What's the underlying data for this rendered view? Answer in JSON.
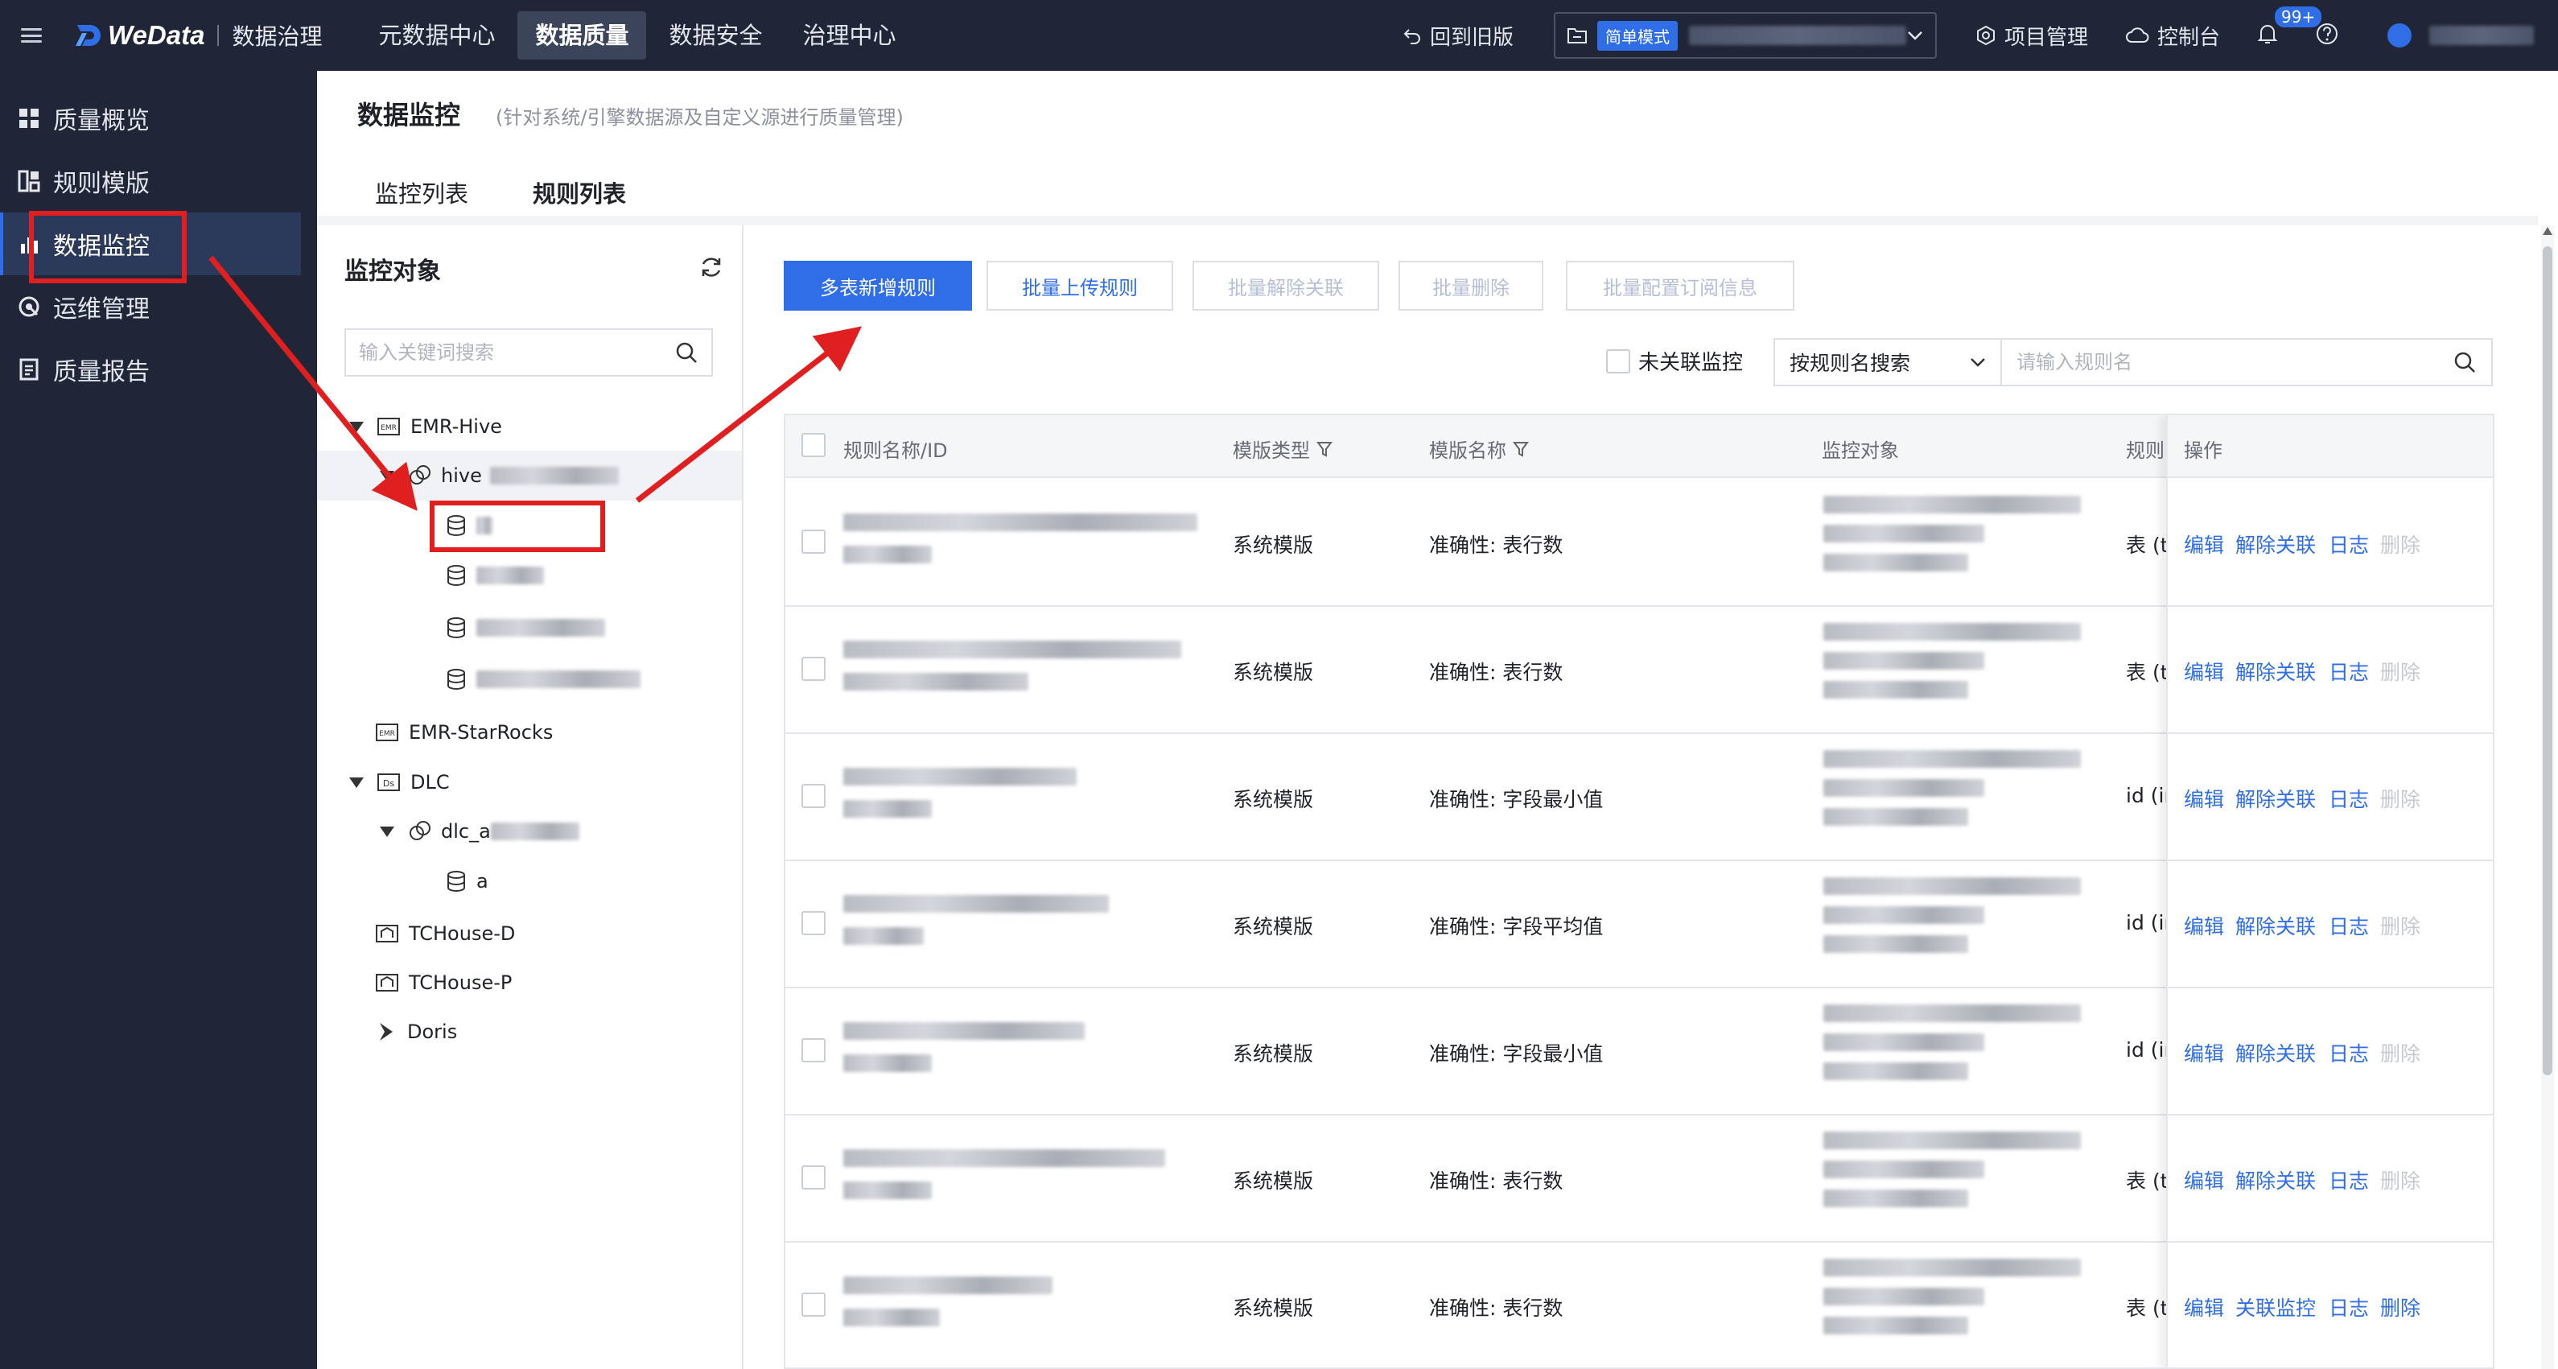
{
  "topbar": {
    "logo_text": "WeData",
    "product": "数据治理",
    "nav": [
      "元数据中心",
      "数据质量",
      "数据安全",
      "治理中心"
    ],
    "active_nav": "数据质量",
    "back_old": "回到旧版",
    "mode_badge": "简单模式",
    "project_mgmt": "项目管理",
    "console": "控制台",
    "notif_count": "99+"
  },
  "sidebar": {
    "items": [
      {
        "label": "质量概览",
        "icon": "grid-icon"
      },
      {
        "label": "规则模版",
        "icon": "template-icon"
      },
      {
        "label": "数据监控",
        "icon": "bar-chart-icon"
      },
      {
        "label": "运维管理",
        "icon": "ops-icon"
      },
      {
        "label": "质量报告",
        "icon": "report-icon"
      }
    ],
    "active": "数据监控"
  },
  "page": {
    "title": "数据监控",
    "desc": "(针对系统/引擎数据源及自定义源进行质量管理)",
    "tabs": [
      "监控列表",
      "规则列表"
    ],
    "active_tab": "规则列表"
  },
  "tree": {
    "title": "监控对象",
    "search_placeholder": "输入关键词搜索",
    "nodes": {
      "emr_hive": "EMR-Hive",
      "hive_db": "hive",
      "emr_starrocks": "EMR-StarRocks",
      "dlc": "DLC",
      "dlc_db": "dlc_a",
      "dlc_table": "a",
      "tchouse_d": "TCHouse-D",
      "tchouse_p": "TCHouse-P",
      "doris": "Doris"
    }
  },
  "toolbar": {
    "add_multi": "多表新增规则",
    "batch_upload": "批量上传规则",
    "batch_unlink": "批量解除关联",
    "batch_delete": "批量删除",
    "batch_subscribe": "批量配置订阅信息",
    "unlinked_label": "未关联监控",
    "search_mode": "按规则名搜索",
    "search_placeholder": "请输入规则名"
  },
  "table": {
    "headers": {
      "name": "规则名称/ID",
      "template_type": "模版类型",
      "template_name": "模版名称",
      "monitor_obj": "监控对象",
      "rule": "规则",
      "ops": "操作"
    },
    "rows": [
      {
        "template_type": "系统模版",
        "template_name": "准确性: 表行数",
        "rule": "表 (t",
        "ops": [
          "编辑",
          "解除关联",
          "日志",
          "删除"
        ],
        "delete_enabled": false
      },
      {
        "template_type": "系统模版",
        "template_name": "准确性: 表行数",
        "rule": "表 (t",
        "ops": [
          "编辑",
          "解除关联",
          "日志",
          "删除"
        ],
        "delete_enabled": false
      },
      {
        "template_type": "系统模版",
        "template_name": "准确性: 字段最小值",
        "rule": "id (ir",
        "ops": [
          "编辑",
          "解除关联",
          "日志",
          "删除"
        ],
        "delete_enabled": false
      },
      {
        "template_type": "系统模版",
        "template_name": "准确性: 字段平均值",
        "rule": "id (ir",
        "ops": [
          "编辑",
          "解除关联",
          "日志",
          "删除"
        ],
        "delete_enabled": false
      },
      {
        "template_type": "系统模版",
        "template_name": "准确性: 字段最小值",
        "rule": "id (ir",
        "ops": [
          "编辑",
          "解除关联",
          "日志",
          "删除"
        ],
        "delete_enabled": false
      },
      {
        "template_type": "系统模版",
        "template_name": "准确性: 表行数",
        "rule": "表 (t",
        "ops": [
          "编辑",
          "解除关联",
          "日志",
          "删除"
        ],
        "delete_enabled": false
      },
      {
        "template_type": "系统模版",
        "template_name": "准确性: 表行数",
        "rule": "表 (t",
        "ops": [
          "编辑",
          "关联监控",
          "日志",
          "删除"
        ],
        "delete_enabled": true
      }
    ]
  },
  "colors": {
    "topbar_bg": "#202637",
    "accent": "#2f6ee6",
    "annotation_red": "#e02020"
  }
}
